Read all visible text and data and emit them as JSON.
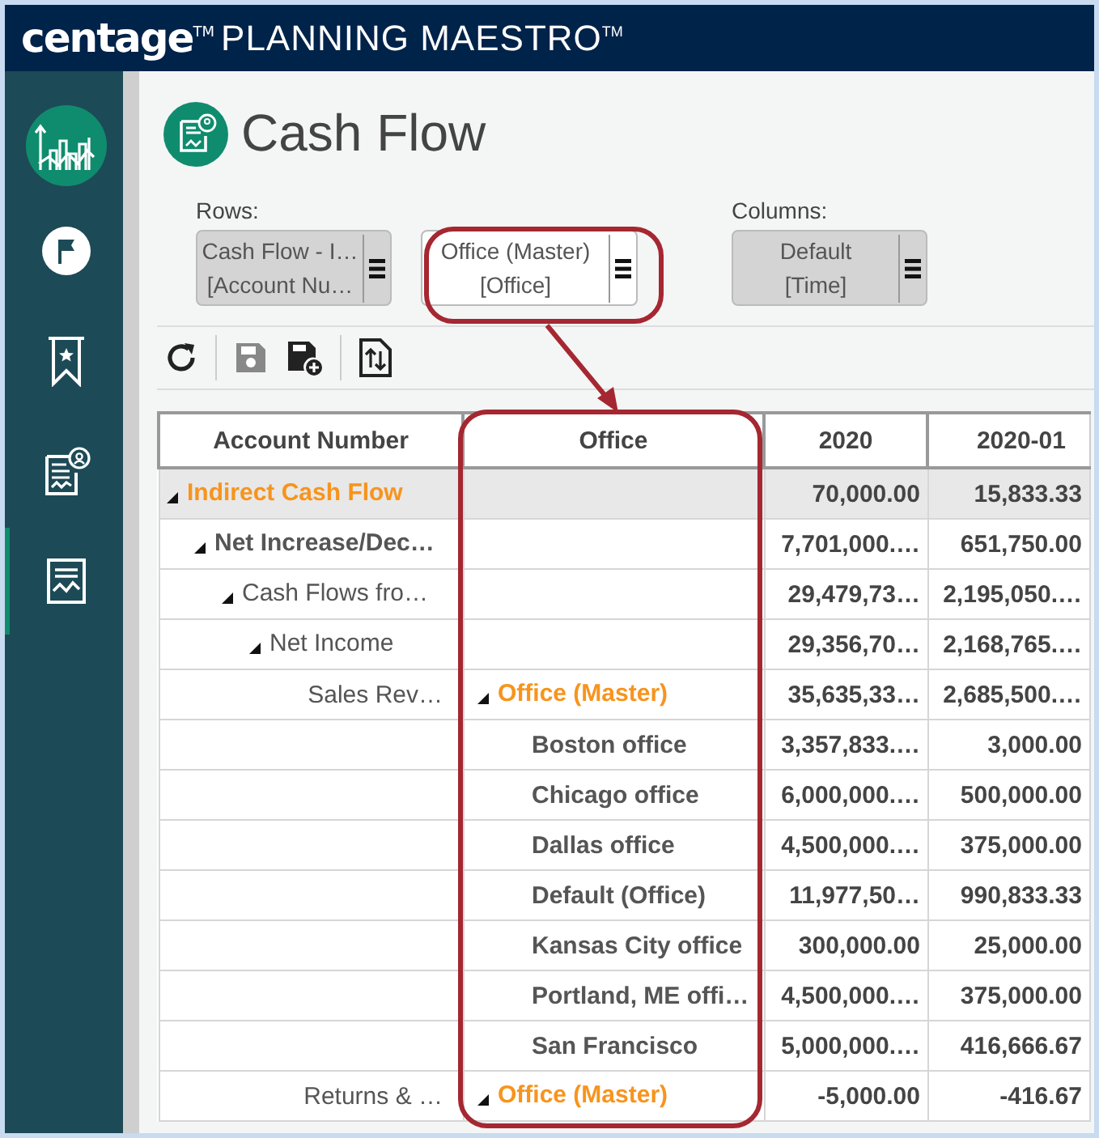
{
  "header": {
    "brand": "centage$^{TM}$",
    "product": "PLANNING MAESTRO$^{TM}$"
  },
  "sidebar": {
    "items": [
      {
        "selected": false
      },
      {
        "selected": false
      },
      {
        "selected": false
      },
      {
        "selected": false
      },
      {
        "selected": true
      }
    ]
  },
  "page": {
    "title": "Cash Flow"
  },
  "pivot": {
    "rows_label": "Rows:",
    "rows": [
      {
        "line1": "Cash Flow - I…",
        "line2": "[Account Nu…",
        "highlighted": false
      },
      {
        "line1": "Office (Master)",
        "line2": "[Office]",
        "highlighted": true
      }
    ],
    "columns_label": "Columns:",
    "columns": [
      {
        "line1": "Default",
        "line2": "[Time]",
        "highlighted": false
      }
    ]
  },
  "toolbar": [
    {
      "disabled": false
    },
    {
      "disabled": true
    },
    {
      "disabled": false
    },
    {
      "disabled": false
    }
  ],
  "table": {
    "columns": [
      "Account Number",
      "Office",
      "2020",
      "2020-01"
    ],
    "rows": [
      {
        "account": "Indirect Cash Flow",
        "expanded": true,
        "selected": true,
        "values": [
          "70,000.00",
          "15,833.33"
        ],
        "children": [
          {
            "account": "Net Increase/Dec…",
            "expanded": true,
            "selected": false,
            "values": [
              "7,701,000.…",
              "651,750.00"
            ],
            "children": [
              {
                "account": "Cash Flows fro…",
                "expanded": true,
                "selected": false,
                "values": [
                  "29,479,73…",
                  "2,195,050.…"
                ],
                "children": [
                  {
                    "account": "Net Income",
                    "expanded": true,
                    "selected": false,
                    "values": [
                      "29,356,70…",
                      "2,168,765.…"
                    ],
                    "children": [
                      {
                        "account": "Sales Rev…",
                        "selected": false,
                        "office": {
                          "name": "Office (Master)",
                          "expanded": true,
                          "values": [
                            "35,635,33…",
                            "2,685,500.…"
                          ],
                          "children": [
                            {
                              "name": "Boston office",
                              "selected": false,
                              "values": [
                                "3,357,833.…",
                                "3,000.00"
                              ]
                            },
                            {
                              "name": "Chicago office",
                              "selected": false,
                              "values": [
                                "6,000,000.…",
                                "500,000.00"
                              ]
                            },
                            {
                              "name": "Dallas office",
                              "selected": false,
                              "values": [
                                "4,500,000.…",
                                "375,000.00"
                              ]
                            },
                            {
                              "name": "Default (Office)",
                              "selected": false,
                              "values": [
                                "11,977,50…",
                                "990,833.33"
                              ]
                            },
                            {
                              "name": "Kansas City office",
                              "selected": false,
                              "values": [
                                "300,000.00",
                                "25,000.00"
                              ]
                            },
                            {
                              "name": "Portland, ME offi…",
                              "selected": false,
                              "values": [
                                "4,500,000.…",
                                "375,000.00"
                              ]
                            },
                            {
                              "name": "San Francisco",
                              "selected": false,
                              "values": [
                                "5,000,000.…",
                                "416,666.67"
                              ]
                            }
                          ]
                        }
                      },
                      {
                        "account": "Returns & …",
                        "selected": false,
                        "office": {
                          "name": "Office (Master)",
                          "expanded": true,
                          "values": [
                            "-5,000.00",
                            "-416.67"
                          ]
                        }
                      }
                    ]
                  }
                ]
              }
            ]
          }
        ]
      }
    ]
  }
}
